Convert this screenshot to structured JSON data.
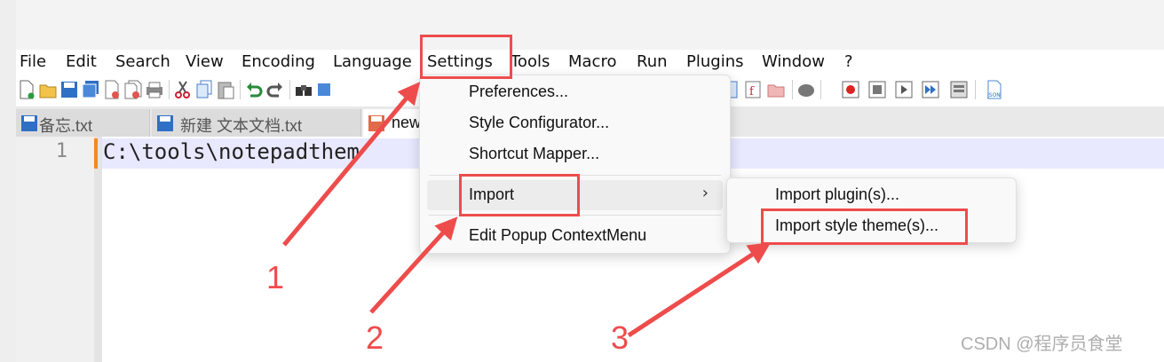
{
  "menubar": {
    "items": [
      "File",
      "Edit",
      "Search",
      "View",
      "Encoding",
      "Language",
      "Settings",
      "Tools",
      "Macro",
      "Run",
      "Plugins",
      "Window",
      "?"
    ]
  },
  "toolbar": {
    "icons": [
      "new-file-icon",
      "open-file-icon",
      "save-icon",
      "save-all-icon",
      "close-icon",
      "close-all-icon",
      "print-icon",
      "cut-icon",
      "copy-icon",
      "paste-icon",
      "undo-icon",
      "redo-icon",
      "find-icon",
      "find-replace-icon",
      "doc-map-icon",
      "function-list-icon",
      "folder-icon",
      "macro-icon",
      "record-icon",
      "stop-icon",
      "play-icon",
      "run-multiple-icon",
      "save-macro-icon",
      "json-icon"
    ]
  },
  "tabs": [
    {
      "label": "备忘.txt"
    },
    {
      "label": "新建 文本文档.txt"
    },
    {
      "label": "new"
    }
  ],
  "editor": {
    "line_number": "1",
    "text": "C:\\tools\\notepadthem"
  },
  "settings_menu": {
    "items": [
      "Preferences...",
      "Style Configurator...",
      "Shortcut Mapper...",
      "Import",
      "Edit Popup ContextMenu"
    ],
    "chevron": "›"
  },
  "import_submenu": {
    "items": [
      "Import plugin(s)...",
      "Import style theme(s)..."
    ]
  },
  "annotations": {
    "numbers": [
      "1",
      "2",
      "3"
    ],
    "color": "#ee4c4c"
  },
  "watermark": "CSDN @程序员食堂"
}
